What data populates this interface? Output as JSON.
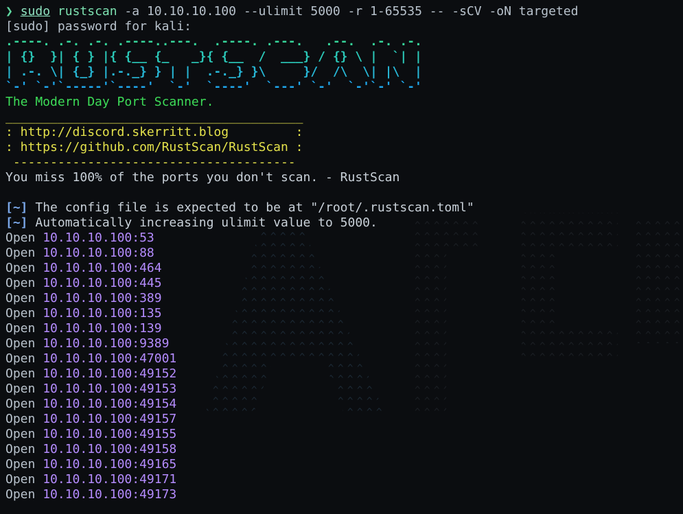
{
  "colors": {
    "background": "#0b0d10",
    "prompt": "#5fd7a0",
    "banner_gradient": [
      "#36d399",
      "#2bc8b8",
      "#27b7d6",
      "#1fa4e8"
    ],
    "tagline": "#3ddc58",
    "links_box": "#e4e24b",
    "info_bracket": "#7aa7e8",
    "open_address": "#b58cff"
  },
  "command": {
    "prompt_glyph": "❯",
    "sudo": "sudo",
    "program": "rustscan",
    "args": " -a 10.10.10.100 --ulimit 5000 -r 1-65535 -- -sCV -oN targeted"
  },
  "sudo_prompt": "[sudo] password for kali:",
  "banner_lines": [
    ".----. .-. .-. .----..---.  .----. .---.   .--.  .-. .-.",
    "| {}  }| { } |{ {__ {_   _}{ {__  /  ___} / {} \\ |  `| |",
    "| .-. \\| {_} |.-._} } | |  .-._} }\\     }/  /\\  \\| |\\  |",
    "`-' `-'`-----'`----'  `-'  `----'  `---' `-'  `-'`-' `-'"
  ],
  "tagline": "The Modern Day Port Scanner.",
  "links_box": [
    "________________________________________",
    ": http://discord.skerritt.blog         :",
    ": https://github.com/RustScan/RustScan :",
    " --------------------------------------"
  ],
  "quote": "You miss 100% of the ports you don't scan. - RustScan",
  "info_lines": [
    {
      "bracket": "[~]",
      "text": " The config file is expected to be at \"/root/.rustscan.toml\""
    },
    {
      "bracket": "[~]",
      "text": " Automatically increasing ulimit value to 5000."
    }
  ],
  "open_label": "Open",
  "open_ports": [
    "10.10.10.100:53",
    "10.10.10.100:88",
    "10.10.10.100:464",
    "10.10.10.100:445",
    "10.10.10.100:389",
    "10.10.10.100:135",
    "10.10.10.100:139",
    "10.10.10.100:9389",
    "10.10.10.100:47001",
    "10.10.10.100:49152",
    "10.10.10.100:49153",
    "10.10.10.100:49154",
    "10.10.10.100:49157",
    "10.10.10.100:49155",
    "10.10.10.100:49158",
    "10.10.10.100:49165",
    "10.10.10.100:49171",
    "10.10.10.100:49173"
  ]
}
